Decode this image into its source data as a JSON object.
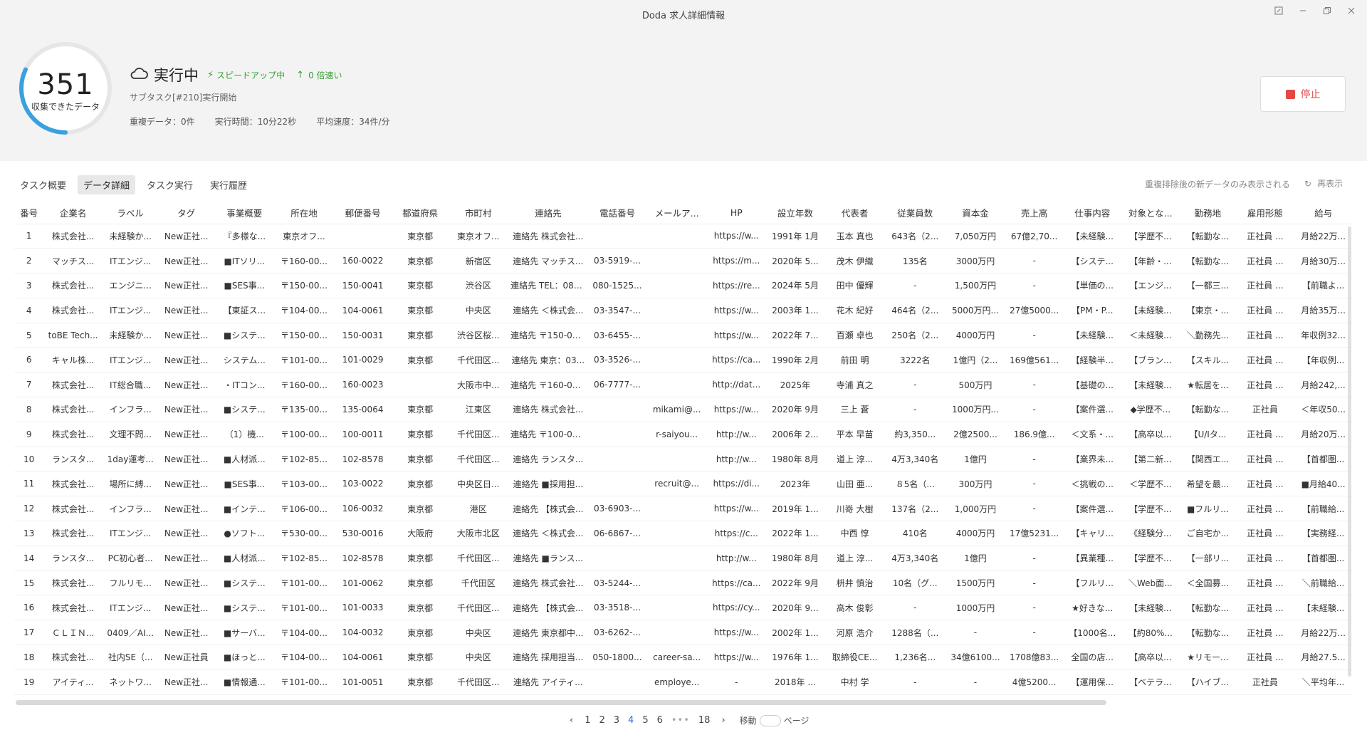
{
  "window": {
    "title": "Doda 求人詳細情報",
    "controls": [
      "edit-icon",
      "minimize-icon",
      "restore-icon",
      "close-icon"
    ]
  },
  "summary": {
    "count": "351",
    "count_label": "収集できたデータ",
    "progress": 0.32,
    "status": "実行中",
    "speedup": "スピードアップ中",
    "faster": "0 倍速い",
    "subtask": "サブタスク[#210]実行開始",
    "duplicate": "重複データ：0件",
    "elapsed": "実行時間：10分22秒",
    "speed": "平均速度：34件/分",
    "stop_label": "停止",
    "colors": {
      "accent": "#3aa0e0",
      "green": "#3a9d3a",
      "stop": "#e64545"
    }
  },
  "tabs": [
    {
      "label": "タスク概要",
      "active": false
    },
    {
      "label": "データ詳細",
      "active": true
    },
    {
      "label": "タスク実行",
      "active": false
    },
    {
      "label": "実行履歴",
      "active": false
    }
  ],
  "dedup_note": "重複排除後の新データのみ表示される",
  "refresh_label": "再表示",
  "table": {
    "columns": [
      "番号",
      "企業名",
      "ラベル",
      "タグ",
      "事業概要",
      "所在地",
      "郵便番号",
      "都道府県",
      "市町村",
      "連絡先",
      "電話番号",
      "メールア...",
      "HP",
      "設立年数",
      "代表者",
      "従業員数",
      "資本金",
      "売上高",
      "仕事内容",
      "対象とな...",
      "勤務地",
      "雇用形態",
      "給与"
    ],
    "rows": [
      [
        "1",
        "株式会社...",
        "未経験か...",
        "New正社...",
        "『多様な...",
        "東京オフ...",
        "",
        "東京都",
        "東京オフ...",
        "連絡先 株式会社...",
        "",
        "",
        "https://w...",
        "1991年 1月",
        "玉本 真也",
        "643名（2...",
        "7,050万円",
        "67億2,70...",
        "【未経験...",
        "【学歴不...",
        "【転勤な...",
        "正社員 ...",
        "月給22万..."
      ],
      [
        "2",
        "マッチス...",
        "ITエンジ...",
        "New正社...",
        "■ITソリ...",
        "〒160-00...",
        "160-0022",
        "東京都",
        "新宿区",
        "連絡先 マッチス...",
        "03-5919-...",
        "",
        "https://m...",
        "2020年 5...",
        "茂木 伊織",
        "135名",
        "3000万円",
        "-",
        "【システ...",
        "【年齢・...",
        "【転勤な...",
        "正社員 ...",
        "月給30万..."
      ],
      [
        "3",
        "株式会社...",
        "エンジニ...",
        "New正社...",
        "■SES事...",
        "〒150-00...",
        "150-0041",
        "東京都",
        "渋谷区",
        "連絡先 TEL：080...",
        "080-1525...",
        "",
        "https://re...",
        "2024年 5月",
        "田中 優輝",
        "-",
        "1,500万円",
        "-",
        "【単価の...",
        "【エンジ...",
        "【一都三...",
        "正社員 ...",
        "【前職よ..."
      ],
      [
        "4",
        "株式会社...",
        "ITエンジ...",
        "New正社...",
        "【東証ス...",
        "〒104-00...",
        "104-0061",
        "東京都",
        "中央区",
        "連絡先 ＜株式会...",
        "03-3547-...",
        "",
        "https://w...",
        "2003年 1...",
        "花木 紀好",
        "464名（2...",
        "5000万円...",
        "27億5000...",
        "【PM・P...",
        "【未経験...",
        "【東京・...",
        "正社員 ...",
        "月給35万..."
      ],
      [
        "5",
        "toBE Tech...",
        "未経験か...",
        "New正社...",
        "■システ...",
        "〒150-00...",
        "150-0031",
        "東京都",
        "渋谷区桜...",
        "連絡先 〒150-00...",
        "03-6455-...",
        "",
        "https://w...",
        "2022年 7...",
        "百瀬 卓也",
        "250名（2...",
        "4000万円",
        "-",
        "【未経験...",
        "＜未経験...",
        "＼勤務先...",
        "正社員 ...",
        "年収例32..."
      ],
      [
        "6",
        "キャル株...",
        "ITエンジ...",
        "New正社...",
        "システム...",
        "〒101-00...",
        "101-0029",
        "東京都",
        "千代田区...",
        "連絡先 東京：03...",
        "03-3526-...",
        "",
        "https://ca...",
        "1990年 2月",
        "前田 明",
        "3222名",
        "1億円（2...",
        "169億561...",
        "【経験半...",
        "【ブラン...",
        "【スキル...",
        "正社員 ...",
        "【年収例..."
      ],
      [
        "7",
        "株式会社...",
        "IT総合職...",
        "New正社...",
        "・ITコン...",
        "〒160-00...",
        "160-0023",
        "",
        "大阪市中...",
        "連絡先 〒160-00...",
        "06-7777-...",
        "",
        "http://dat...",
        "2025年",
        "寺浦 真之",
        "-",
        "500万円",
        "-",
        "【基礎の...",
        "【未経験...",
        "★転居を...",
        "正社員 ...",
        "月給242,..."
      ],
      [
        "8",
        "株式会社...",
        "インフラ...",
        "New正社...",
        "■システ...",
        "〒135-00...",
        "135-0064",
        "東京都",
        "江東区",
        "連絡先 株式会社...",
        "",
        "mikami@...",
        "https://w...",
        "2020年 9月",
        "三上 蒼",
        "-",
        "1000万円...",
        "-",
        "【案件選...",
        "◆学歴不...",
        "【転勤な...",
        "正社員",
        "＜年収50..."
      ],
      [
        "9",
        "株式会社...",
        "文理不問...",
        "New正社...",
        "（1）機...",
        "〒100-00...",
        "100-0011",
        "東京都",
        "千代田区...",
        "連絡先 〒100-00...",
        "",
        "r-saiyou...",
        "http://w...",
        "2006年 2...",
        "平本 早苗",
        "約3,350...",
        "2億2500...",
        "186.9億...",
        "＜文系・...",
        "【高卒以...",
        "【U/Iタ...",
        "正社員 ...",
        "月給20万..."
      ],
      [
        "10",
        "ランスタ...",
        "1day運考...",
        "New正社...",
        "■人材派...",
        "〒102-85...",
        "102-8578",
        "東京都",
        "千代田区...",
        "連絡先 ランスタ...",
        "",
        "",
        "http://w...",
        "1980年 8月",
        "道上 淳...",
        "4万3,340名",
        "1億円",
        "-",
        "【業界未...",
        "【第二新...",
        "【関西エ...",
        "正社員 ...",
        "【首都圏..."
      ],
      [
        "11",
        "株式会社...",
        "場所に縛...",
        "New正社...",
        "■SES事...",
        "〒103-00...",
        "103-0022",
        "東京都",
        "中央区日...",
        "連絡先 ■採用担...",
        "",
        "recruit@...",
        "https://di...",
        "2023年",
        "山田 亜...",
        "８5名（...",
        "300万円",
        "-",
        "＜挑戦の...",
        "＜学歴不...",
        "希望を最...",
        "正社員 ...",
        "■月給40..."
      ],
      [
        "12",
        "株式会社...",
        "インフラ...",
        "New正社...",
        "■インテ...",
        "〒106-00...",
        "106-0032",
        "東京都",
        "港区",
        "連絡先 【株式会...",
        "03-6903-...",
        "",
        "https://w...",
        "2019年 1...",
        "川嵜 大樹",
        "137名（2...",
        "1,000万円",
        "-",
        "【案件選...",
        "【学歴不...",
        "■フルリ...",
        "正社員 ...",
        "【前職給..."
      ],
      [
        "13",
        "株式会社...",
        "ITエンジ...",
        "New正社...",
        "●ソフト...",
        "〒530-00...",
        "530-0016",
        "大阪府",
        "大阪市北区",
        "連絡先 ＜株式会...",
        "06-6867-...",
        "",
        "https://c...",
        "2022年 1...",
        "中西 惇",
        "410名",
        "4000万円",
        "17億5231...",
        "【キャリ...",
        "《経験分...",
        "ご自宅か...",
        "正社員 ...",
        "【実務経..."
      ],
      [
        "14",
        "ランスタ...",
        "PC初心者...",
        "New正社...",
        "■人材派...",
        "〒102-85...",
        "102-8578",
        "東京都",
        "千代田区...",
        "連絡先 ■ランス...",
        "",
        "",
        "http://w...",
        "1980年 8月",
        "道上 淳...",
        "4万3,340名",
        "1億円",
        "-",
        "【異業種...",
        "【学歴不...",
        "【一部リ...",
        "正社員 ...",
        "【首都圏..."
      ],
      [
        "15",
        "株式会社...",
        "フルリモ...",
        "New正社...",
        "■システ...",
        "〒101-00...",
        "101-0062",
        "東京都",
        "千代田区",
        "連絡先 株式会社...",
        "03-5244-...",
        "",
        "https://ca...",
        "2022年 9月",
        "枡井 慎治",
        "10名（グ...",
        "1500万円",
        "-",
        "【フルリ...",
        "＼Web面...",
        "＜全国募...",
        "正社員 ...",
        "＼前職給..."
      ],
      [
        "16",
        "株式会社...",
        "ITエンジ...",
        "New正社...",
        "■システ...",
        "〒101-00...",
        "101-0033",
        "東京都",
        "千代田区...",
        "連絡先 【株式会...",
        "03-3518-...",
        "",
        "https://cy...",
        "2020年 9...",
        "高木 俊彰",
        "-",
        "1000万円",
        "-",
        "★好きな...",
        "【未経験...",
        "【転勤な...",
        "正社員 ...",
        "【未経験..."
      ],
      [
        "17",
        "ＣＬＩＮ...",
        "0409／AI...",
        "New正社...",
        "■サーバ...",
        "〒104-00...",
        "104-0032",
        "東京都",
        "中央区",
        "連絡先 東京都中...",
        "03-6262-...",
        "",
        "https://w...",
        "2002年 1...",
        "河原 浩介",
        "1288名（...",
        "-",
        "-",
        "【1000名...",
        "【約80%...",
        "【転勤な...",
        "正社員 ...",
        "月給22万..."
      ],
      [
        "18",
        "株式会社...",
        "社内SE（...",
        "New正社員",
        "■ほっと...",
        "〒104-00...",
        "104-0061",
        "東京都",
        "中央区",
        "連絡先 採用担当...",
        "050-1800...",
        "career-sa...",
        "https://w...",
        "1976年 1...",
        "取締役CE...",
        "1,236名...",
        "34億6100...",
        "1708億83...",
        "全国の店...",
        "【高卒以...",
        "★リモー...",
        "正社員 ...",
        "月給27.5..."
      ],
      [
        "19",
        "アイティ...",
        "ネットワ...",
        "New正社...",
        "■情報通...",
        "〒101-00...",
        "101-0051",
        "東京都",
        "千代田区...",
        "連絡先 アイティ...",
        "",
        "employe...",
        "-",
        "2018年 ...",
        "中村 学",
        "-",
        "-",
        "4億5200...",
        "【運用保...",
        "【ベテラ...",
        "【ハイブ...",
        "正社員",
        "＼平均年..."
      ]
    ]
  },
  "pager": {
    "pages": [
      "1",
      "2",
      "3",
      "4",
      "5",
      "6"
    ],
    "current": "4",
    "ellipsis": "•••",
    "last": "18",
    "goto_label": "移動",
    "page_label": "ページ"
  }
}
